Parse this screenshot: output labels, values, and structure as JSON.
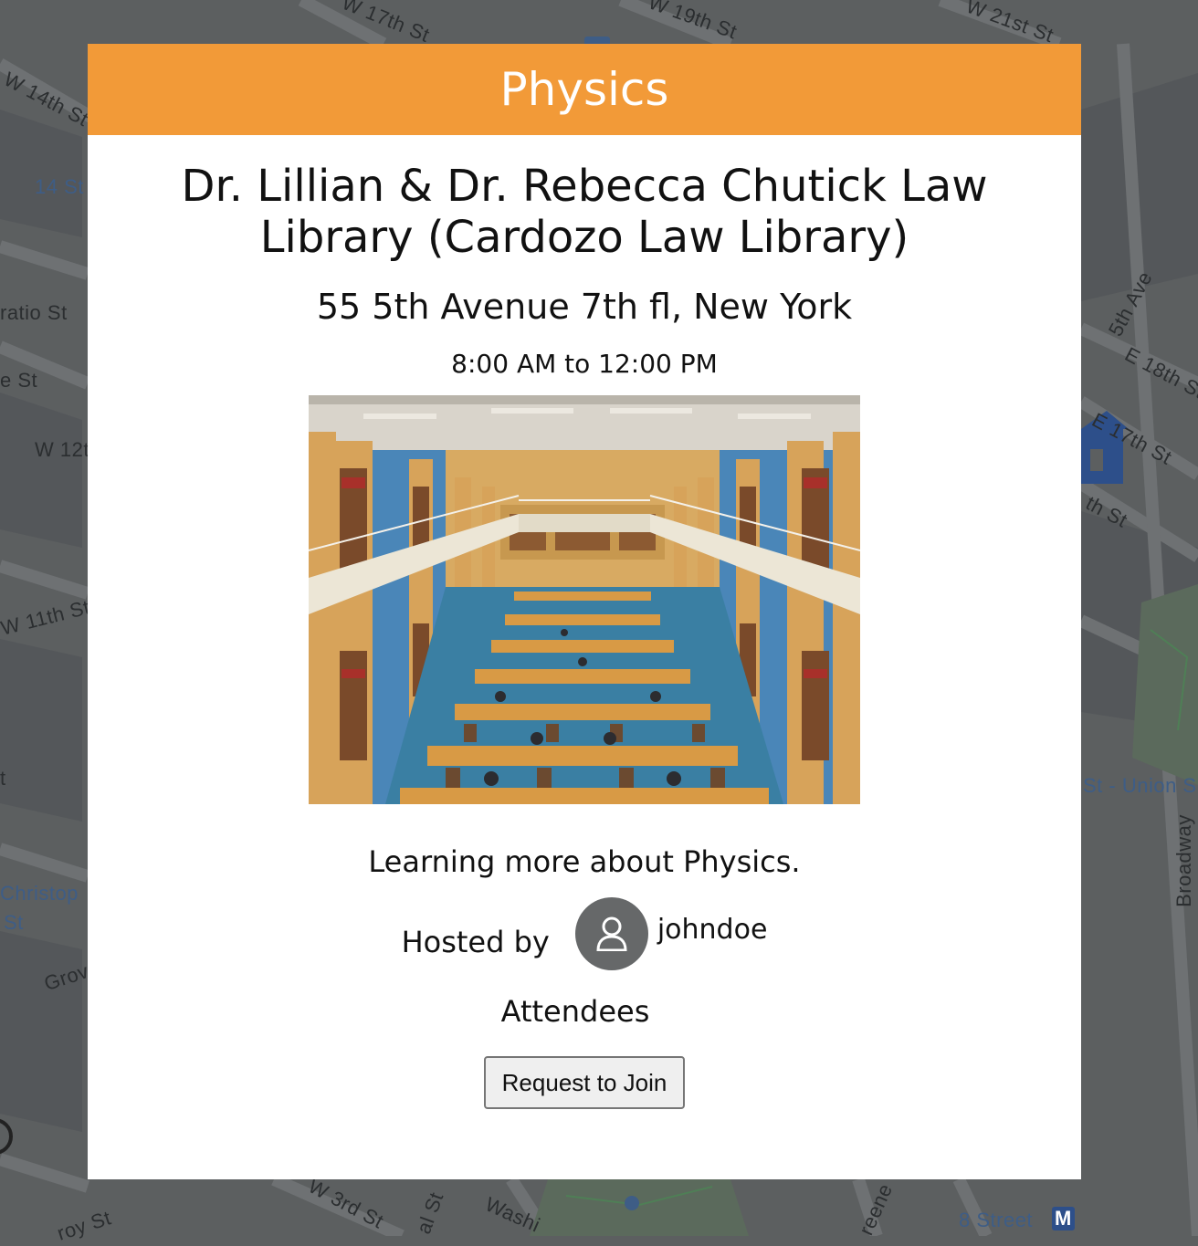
{
  "map": {
    "street_labels": [
      "W 14th St",
      "14 St",
      "ratio St",
      "e St",
      "W 12t",
      "W 11th St",
      "t",
      "Christop",
      "St",
      "Grov",
      "roy St",
      "W 3rd St",
      "al St",
      "Washi",
      "reene",
      "8 Street",
      "M",
      "St - Union S",
      "Broadway",
      "E 17th St",
      "th St",
      "E 18th St",
      "5th Ave",
      "W 17th St",
      "W 19th St",
      "W 21st St"
    ]
  },
  "event": {
    "category": "Physics",
    "venue_name": "Dr. Lillian & Dr. Rebecca Chutick Law Library (Cardozo Law Library)",
    "address": "55 5th Avenue 7th fl, New York",
    "time_range": "8:00 AM to 12:00 PM",
    "description": "Learning more about Physics.",
    "hosted_by_label": "Hosted by",
    "host_username": "johndoe",
    "attendees_heading": "Attendees",
    "request_join_label": "Request to Join"
  },
  "colors": {
    "header": "#f29a38",
    "map_background": "#5c5f60",
    "avatar": "#666869"
  }
}
